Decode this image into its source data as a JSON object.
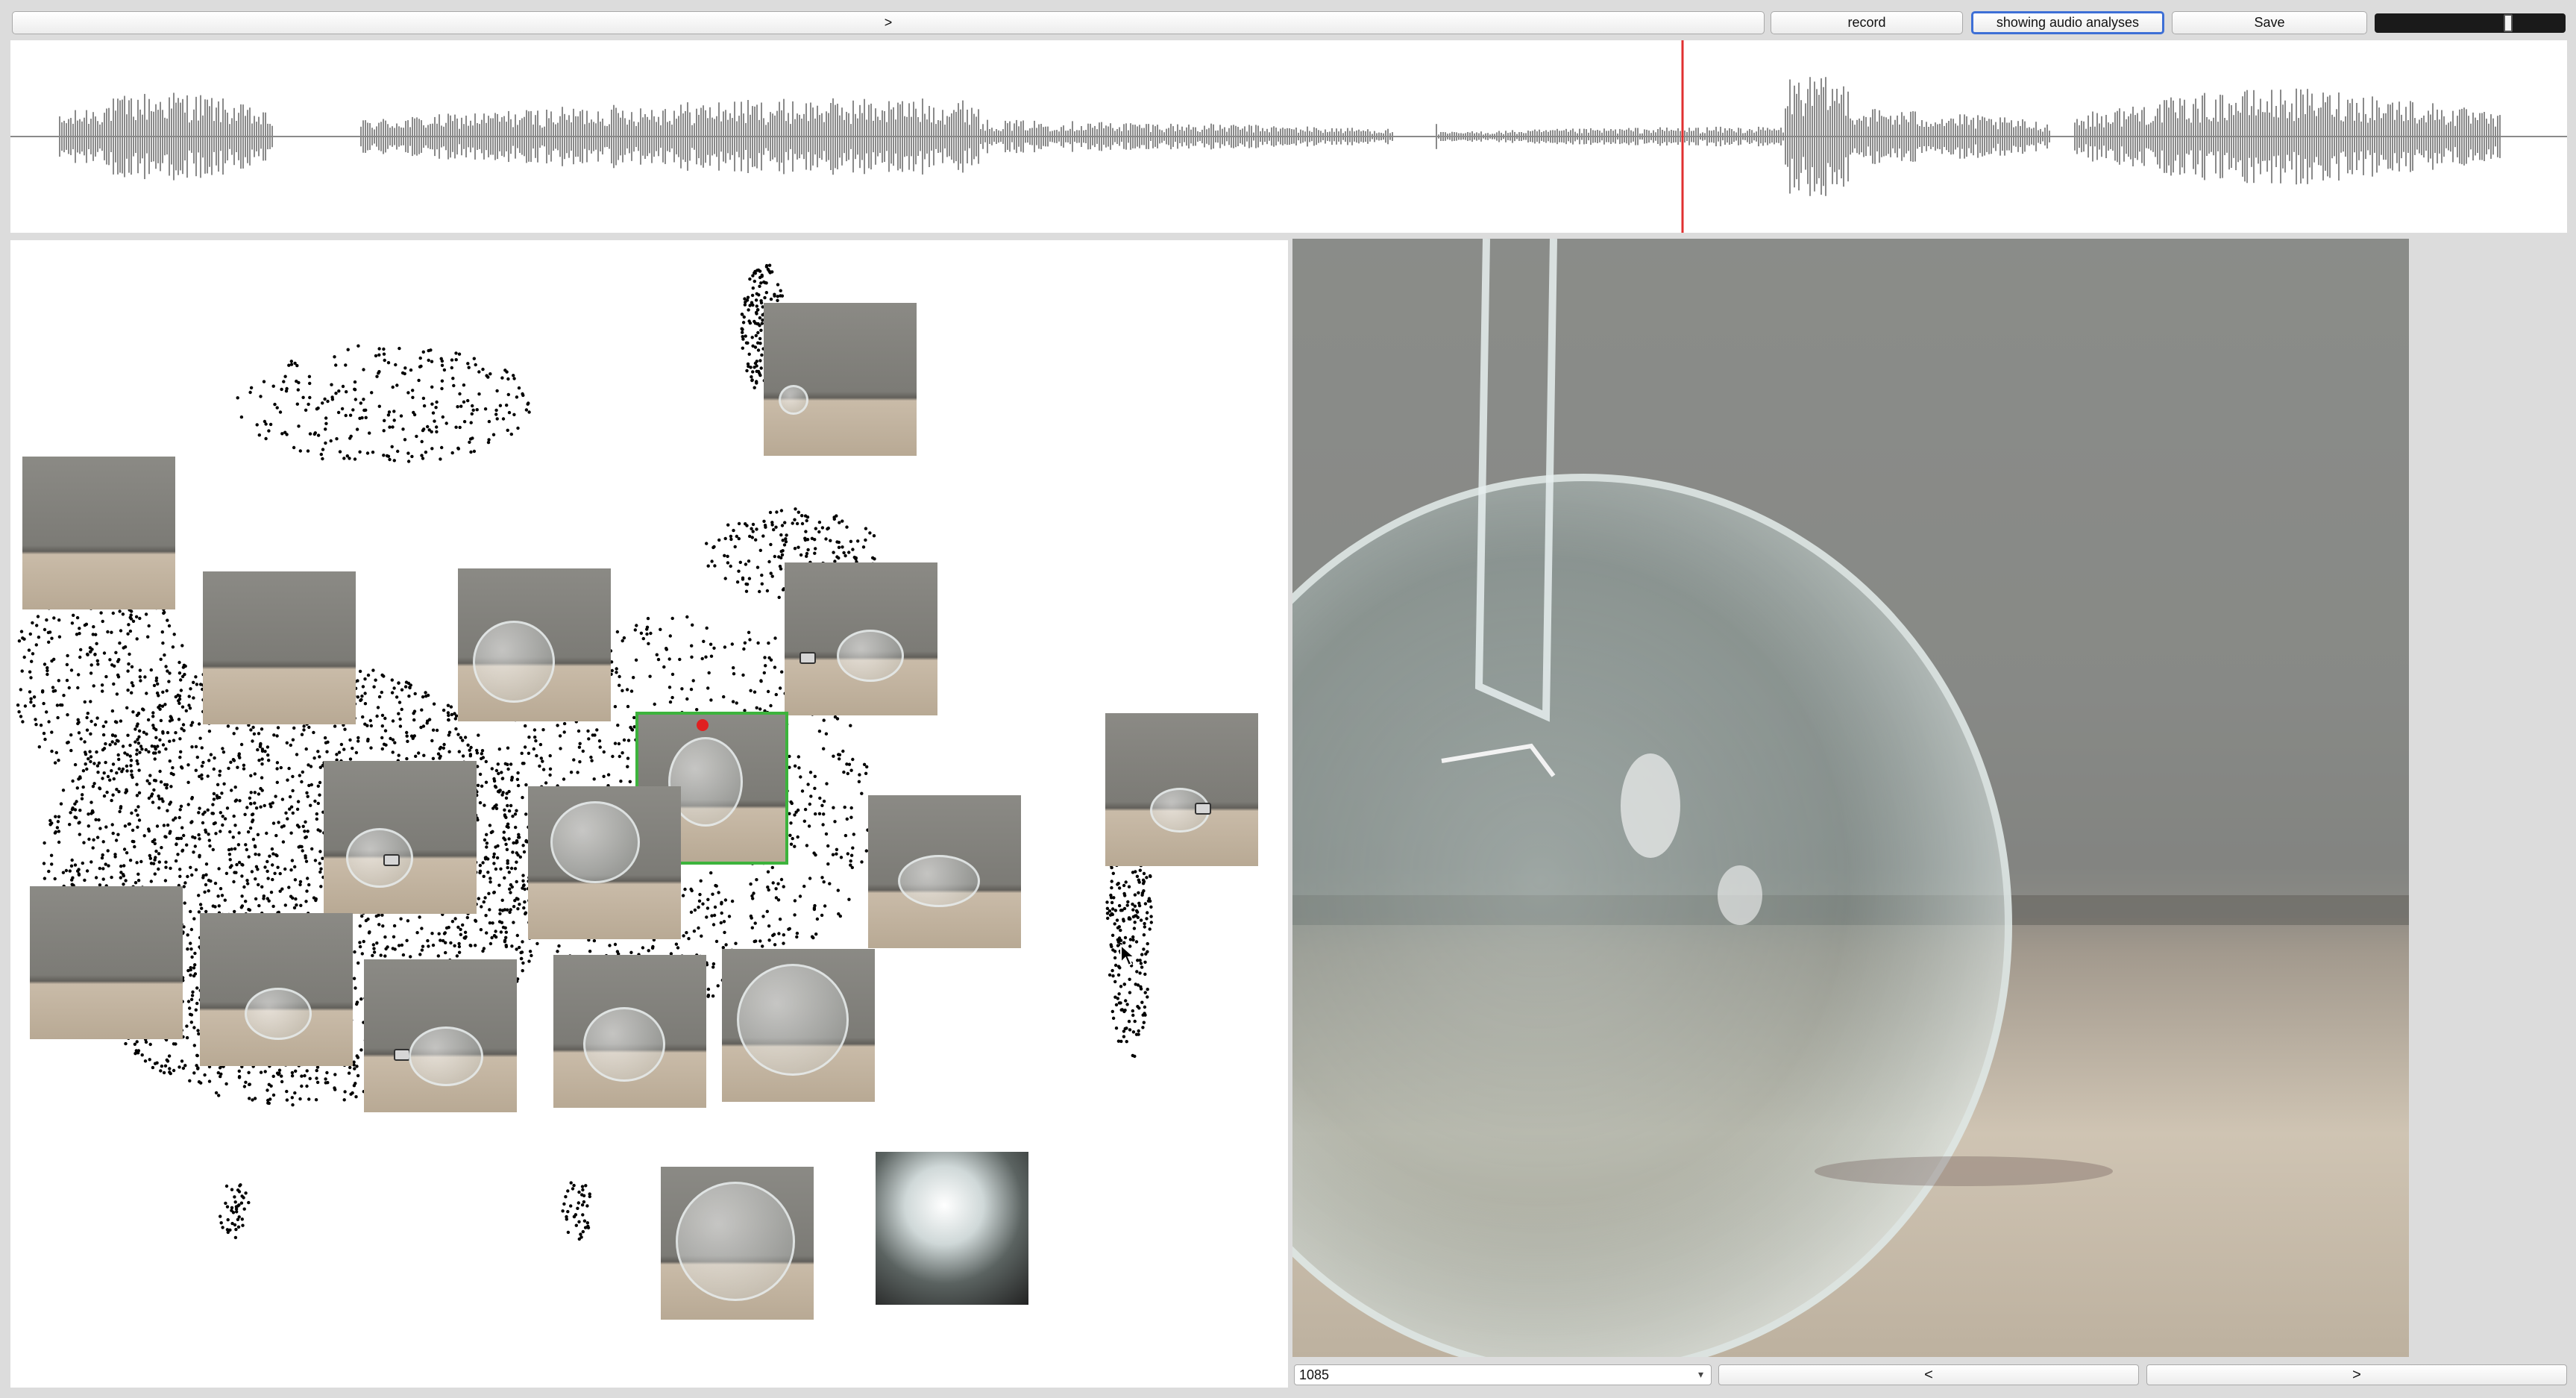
{
  "toolbar": {
    "expand_label": ">",
    "record_label": "record",
    "analyses_label": "showing audio analyses",
    "save_label": "Save",
    "slider_level": 0.72
  },
  "waveform": {
    "color": "#8a8a8a",
    "playhead_color": "#e03030",
    "playhead_position": 0.654
  },
  "map": {
    "point_color": "#000000",
    "selection_color": "#3cb33c",
    "marker_color": "#e02020",
    "thumbnail_count": 17
  },
  "viewer": {
    "frame_value": "1085",
    "prev_label": "<",
    "next_label": ">"
  },
  "icons": {
    "dropdown": "chevron-down-icon",
    "cursor": "mouse-pointer-icon"
  }
}
